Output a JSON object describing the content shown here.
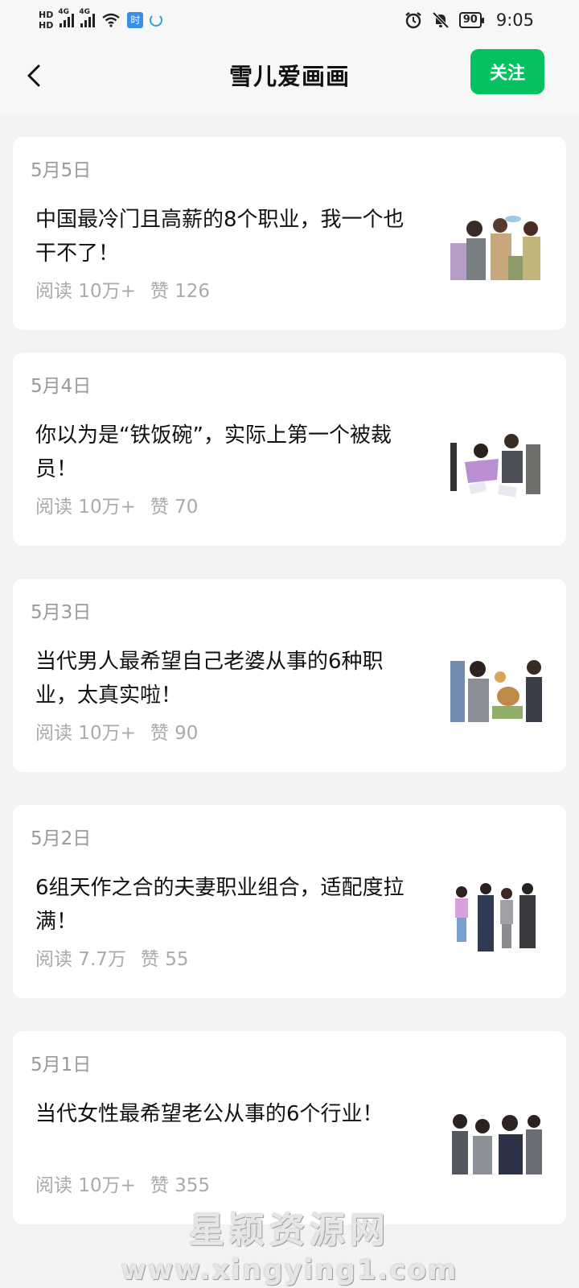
{
  "status_bar": {
    "hd_top": "HD",
    "hd_bottom": "HD",
    "net1": "4G",
    "net2": "4G",
    "app_badge": "时",
    "battery": "90",
    "time": "9:05"
  },
  "header": {
    "title": "雪儿爱画画",
    "follow_label": "关注"
  },
  "articles": [
    {
      "date": "5月5日",
      "title": "中国最冷门且高薪的8个职业，我一个也干不了！",
      "reads": "阅读 10万+",
      "likes": "赞 126"
    },
    {
      "date": "5月4日",
      "title": "你以为是“铁饭碗”，实际上第一个被裁员！",
      "reads": "阅读 10万+",
      "likes": "赞 70"
    },
    {
      "date": "5月3日",
      "title": "当代男人最希望自己老婆从事的6种职业，太真实啦！",
      "reads": "阅读 10万+",
      "likes": "赞 90"
    },
    {
      "date": "5月2日",
      "title": "6组天作之合的夫妻职业组合，适配度拉满！",
      "reads": "阅读 7.7万",
      "likes": "赞 55"
    },
    {
      "date": "5月1日",
      "title": "当代女性最希望老公从事的6个行业！",
      "reads": "阅读 10万+",
      "likes": "赞 355"
    }
  ],
  "watermark": {
    "line1": "星颖资源网",
    "line2": "www.xingying1.com"
  },
  "colors": {
    "accent": "#07c160",
    "background": "#f3f3f3"
  }
}
